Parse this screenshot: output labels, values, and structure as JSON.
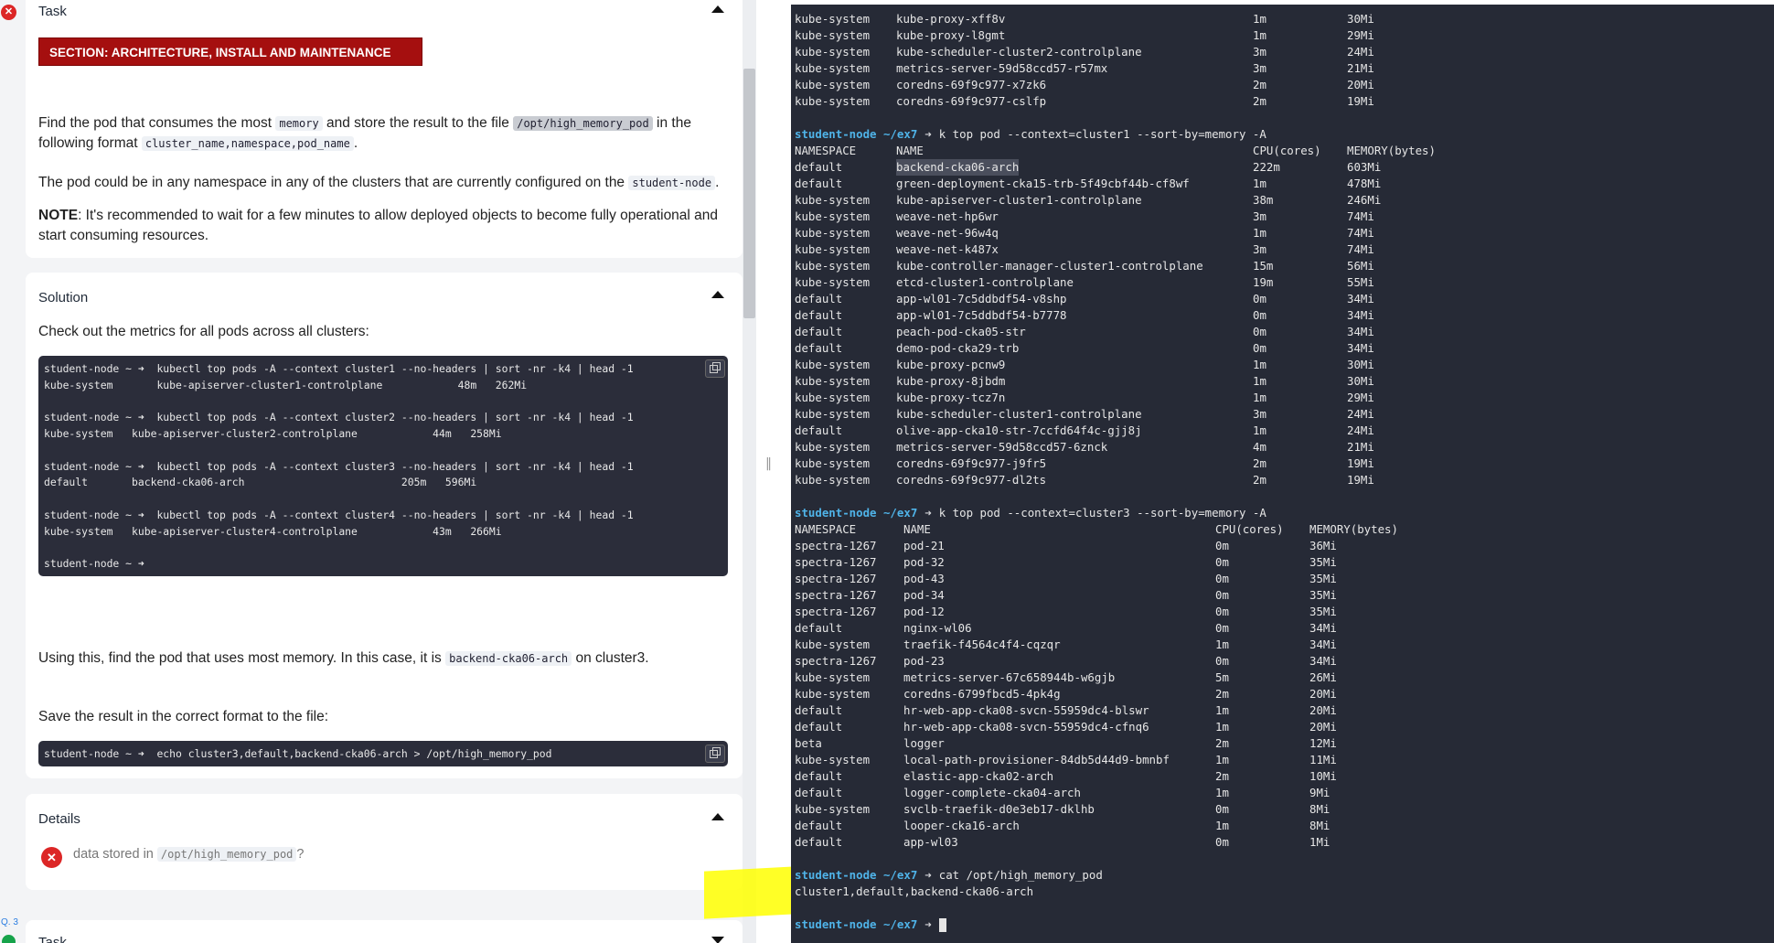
{
  "left": {
    "task": {
      "title": "Task",
      "section_banner": "SECTION: ARCHITECTURE, INSTALL AND MAINTENANCE",
      "p1_a": "Find the pod that consumes the most ",
      "p1_code1": "memory",
      "p1_b": " and store the result to the file ",
      "p1_code2": "/opt/high_memory_pod",
      "p1_c": " in the",
      "p1_d": "following format ",
      "p1_code3": "cluster_name,namespace,pod_name",
      "p1_e": ".",
      "p2_a": "The pod could be in any namespace in any of the clusters that are currently configured on the ",
      "p2_code": "student-node",
      "p2_b": ".",
      "note_label": "NOTE",
      "note_text1": ": It's recommended to wait for a few minutes to allow deployed objects to become fully operational and",
      "note_text2": "start consuming resources."
    },
    "solution": {
      "title": "Solution",
      "intro": "Check out the metrics for all pods across all clusters:",
      "code_lines": [
        "student-node ~ ➜  kubectl top pods -A --context cluster1 --no-headers | sort -nr -k4 | head -1",
        "kube-system       kube-apiserver-cluster1-controlplane            48m   262Mi",
        "",
        "student-node ~ ➜  kubectl top pods -A --context cluster2 --no-headers | sort -nr -k4 | head -1",
        "kube-system   kube-apiserver-cluster2-controlplane            44m   258Mi",
        "",
        "student-node ~ ➜  kubectl top pods -A --context cluster3 --no-headers | sort -nr -k4 | head -1",
        "default       backend-cka06-arch                         205m   596Mi",
        "",
        "student-node ~ ➜  kubectl top pods -A --context cluster4 --no-headers | sort -nr -k4 | head -1",
        "kube-system   kube-apiserver-cluster4-controlplane            43m   266Mi",
        "",
        "student-node ~ ➜"
      ],
      "using_a": "Using this, find the pod that uses most memory. In this case, it is ",
      "using_code": "backend-cka06-arch",
      "using_b": " on cluster3.",
      "save_text": "Save the result in the correct format to the file:",
      "save_code": "student-node ~ ➜  echo cluster3,default,backend-cka06-arch > /opt/high_memory_pod"
    },
    "details": {
      "title": "Details",
      "check_a": "data stored in ",
      "check_code": "/opt/high_memory_pod",
      "check_b": "?"
    },
    "next": {
      "q_label": "Q. 3",
      "title": "Task"
    }
  },
  "terminal": {
    "top_rows": [
      [
        "kube-system",
        "kube-proxy-xff8v",
        "1m",
        "30Mi"
      ],
      [
        "kube-system",
        "kube-proxy-l8gmt",
        "1m",
        "29Mi"
      ],
      [
        "kube-system",
        "kube-scheduler-cluster2-controlplane",
        "3m",
        "24Mi"
      ],
      [
        "kube-system",
        "metrics-server-59d58ccd57-r57mx",
        "3m",
        "21Mi"
      ],
      [
        "kube-system",
        "coredns-69f9c977-x7zk6",
        "2m",
        "20Mi"
      ],
      [
        "kube-system",
        "coredns-69f9c977-cslfp",
        "2m",
        "19Mi"
      ]
    ],
    "prompt_host": "student-node ~/ex7",
    "arrow": "➜",
    "cmd1": "k top pod --context=cluster1 --sort-by=memory -A",
    "headers": [
      "NAMESPACE",
      "NAME",
      "CPU(cores)",
      "MEMORY(bytes)"
    ],
    "cluster1_rows": [
      [
        "default",
        "backend-cka06-arch",
        "222m",
        "603Mi"
      ],
      [
        "default",
        "green-deployment-cka15-trb-5f49cbf44b-cf8wf",
        "1m",
        "478Mi"
      ],
      [
        "kube-system",
        "kube-apiserver-cluster1-controlplane",
        "38m",
        "246Mi"
      ],
      [
        "kube-system",
        "weave-net-hp6wr",
        "3m",
        "74Mi"
      ],
      [
        "kube-system",
        "weave-net-96w4q",
        "1m",
        "74Mi"
      ],
      [
        "kube-system",
        "weave-net-k487x",
        "3m",
        "74Mi"
      ],
      [
        "kube-system",
        "kube-controller-manager-cluster1-controlplane",
        "15m",
        "56Mi"
      ],
      [
        "kube-system",
        "etcd-cluster1-controlplane",
        "19m",
        "55Mi"
      ],
      [
        "default",
        "app-wl01-7c5ddbdf54-v8shp",
        "0m",
        "34Mi"
      ],
      [
        "default",
        "app-wl01-7c5ddbdf54-b7778",
        "0m",
        "34Mi"
      ],
      [
        "default",
        "peach-pod-cka05-str",
        "0m",
        "34Mi"
      ],
      [
        "default",
        "demo-pod-cka29-trb",
        "0m",
        "34Mi"
      ],
      [
        "kube-system",
        "kube-proxy-pcnw9",
        "1m",
        "30Mi"
      ],
      [
        "kube-system",
        "kube-proxy-8jbdm",
        "1m",
        "30Mi"
      ],
      [
        "kube-system",
        "kube-proxy-tcz7n",
        "1m",
        "29Mi"
      ],
      [
        "kube-system",
        "kube-scheduler-cluster1-controlplane",
        "3m",
        "24Mi"
      ],
      [
        "default",
        "olive-app-cka10-str-7ccfd64f4c-gjj8j",
        "1m",
        "24Mi"
      ],
      [
        "kube-system",
        "metrics-server-59d58ccd57-6znck",
        "4m",
        "21Mi"
      ],
      [
        "kube-system",
        "coredns-69f9c977-j9fr5",
        "2m",
        "19Mi"
      ],
      [
        "kube-system",
        "coredns-69f9c977-dl2ts",
        "2m",
        "19Mi"
      ]
    ],
    "cmd2": "k top pod --context=cluster3 --sort-by=memory -A",
    "cluster3_rows": [
      [
        "spectra-1267",
        "pod-21",
        "0m",
        "36Mi"
      ],
      [
        "spectra-1267",
        "pod-32",
        "0m",
        "35Mi"
      ],
      [
        "spectra-1267",
        "pod-43",
        "0m",
        "35Mi"
      ],
      [
        "spectra-1267",
        "pod-34",
        "0m",
        "35Mi"
      ],
      [
        "spectra-1267",
        "pod-12",
        "0m",
        "35Mi"
      ],
      [
        "default",
        "nginx-wl06",
        "0m",
        "34Mi"
      ],
      [
        "kube-system",
        "traefik-f4564c4f4-cqzqr",
        "1m",
        "34Mi"
      ],
      [
        "spectra-1267",
        "pod-23",
        "0m",
        "34Mi"
      ],
      [
        "kube-system",
        "metrics-server-67c658944b-w6gjb",
        "5m",
        "26Mi"
      ],
      [
        "kube-system",
        "coredns-6799fbcd5-4pk4g",
        "2m",
        "20Mi"
      ],
      [
        "default",
        "hr-web-app-cka08-svcn-55959dc4-blswr",
        "1m",
        "20Mi"
      ],
      [
        "default",
        "hr-web-app-cka08-svcn-55959dc4-cfnq6",
        "1m",
        "20Mi"
      ],
      [
        "beta",
        "logger",
        "2m",
        "12Mi"
      ],
      [
        "kube-system",
        "local-path-provisioner-84db5d44d9-bmnbf",
        "1m",
        "11Mi"
      ],
      [
        "default",
        "elastic-app-cka02-arch",
        "2m",
        "10Mi"
      ],
      [
        "default",
        "logger-complete-cka04-arch",
        "1m",
        "9Mi"
      ],
      [
        "kube-system",
        "svclb-traefik-d0e3eb17-dklhb",
        "0m",
        "8Mi"
      ],
      [
        "default",
        "looper-cka16-arch",
        "1m",
        "8Mi"
      ],
      [
        "default",
        "app-wl03",
        "0m",
        "1Mi"
      ]
    ],
    "cmd3": "cat /opt/high_memory_pod",
    "cat_output": "cluster1,default,backend-cka06-arch",
    "colors": {
      "background": "#262a36",
      "prompt": "#4fb3e8",
      "banner": "#a50f0f",
      "highlight": "#ffff00"
    }
  }
}
